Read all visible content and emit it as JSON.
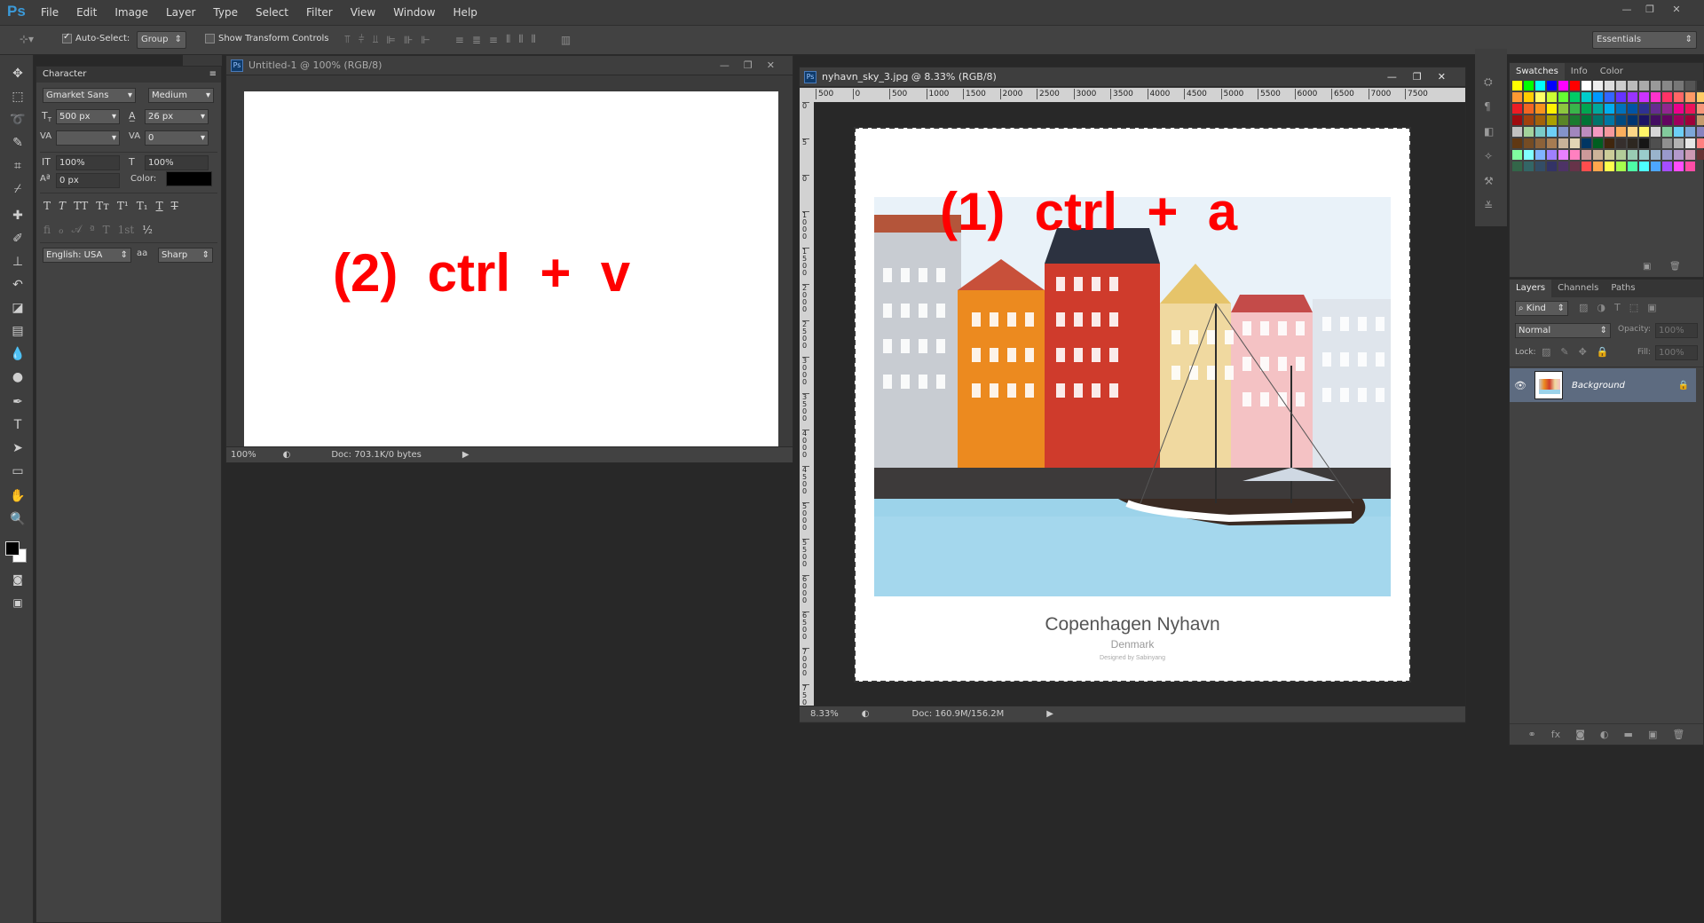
{
  "app": {
    "logo": "Ps",
    "menus": [
      "File",
      "Edit",
      "Image",
      "Layer",
      "Type",
      "Select",
      "Filter",
      "View",
      "Window",
      "Help"
    ],
    "workspace": "Essentials"
  },
  "options": {
    "auto_select_label": "Auto-Select:",
    "auto_select_checked": true,
    "auto_select_value": "Group",
    "show_transform_label": "Show Transform Controls",
    "show_transform_checked": false
  },
  "tools": [
    "move-icon",
    "marquee-icon",
    "lasso-icon",
    "quick-select-icon",
    "crop-icon",
    "eyedropper-icon",
    "spot-heal-icon",
    "brush-icon",
    "stamp-icon",
    "history-brush-icon",
    "eraser-icon",
    "gradient-icon",
    "blur-icon",
    "dodge-icon",
    "pen-icon",
    "type-icon",
    "path-select-icon",
    "shape-icon",
    "hand-icon",
    "zoom-icon"
  ],
  "character": {
    "title": "Character",
    "font_family": "Gmarket Sans",
    "font_style": "Medium",
    "size": "500 px",
    "leading": "26 px",
    "kerning": "",
    "tracking": "0",
    "vscale": "100%",
    "hscale": "100%",
    "baseline": "0 px",
    "color_label": "Color:",
    "color": "#000000",
    "language": "English: USA",
    "aa_label": "aa",
    "antialias": "Sharp"
  },
  "doc1": {
    "title": "Untitled-1 @ 100% (RGB/8)",
    "zoom": "100%",
    "status": "Doc: 703.1K/0 bytes",
    "annotation": "(2)  ctrl  +  v"
  },
  "doc2": {
    "title": "nyhavn_sky_3.jpg @ 8.33% (RGB/8)",
    "zoom": "8.33%",
    "status": "Doc: 160.9M/156.2M",
    "ruler_h": [
      "500",
      "0",
      "500",
      "1000",
      "1500",
      "2000",
      "2500",
      "3000",
      "3500",
      "4000",
      "4500",
      "5000",
      "5500",
      "6000",
      "6500",
      "7000",
      "7500"
    ],
    "ruler_v": [
      "0",
      "5",
      "0",
      "1000",
      "1500",
      "2000",
      "2500",
      "3000",
      "3500",
      "4000",
      "4500",
      "5000",
      "5500",
      "6000",
      "6500",
      "7000",
      "7500"
    ],
    "annotation": "(1)  ctrl  +  a",
    "poster_title": "Copenhagen Nyhavn",
    "poster_subtitle": "Denmark",
    "poster_credit": "Designed by Sabinyang"
  },
  "swatches_panel": {
    "tabs": [
      "Swatches",
      "Info",
      "Color"
    ],
    "colors": [
      "#ffff00",
      "#00ff00",
      "#00ffff",
      "#0000ff",
      "#ff00ff",
      "#ff0000",
      "#ffffff",
      "#eeeeee",
      "#dddddd",
      "#cccccc",
      "#bbbbbb",
      "#aaaaaa",
      "#999999",
      "#888888",
      "#777777",
      "#555555",
      "#333333",
      "#000000",
      "#ff0000",
      "#ff6600",
      "#ff9933",
      "#ffcc00",
      "#ffff66",
      "#ccff33",
      "#66ff33",
      "#00cc66",
      "#00cccc",
      "#0099ff",
      "#3366ff",
      "#6633ff",
      "#9933ff",
      "#cc33ff",
      "#ff33cc",
      "#ff3366",
      "#ff6666",
      "#ff9966",
      "#ffcc66",
      "#ffff99",
      "#ccff99",
      "#99ff99",
      "#ed1c24",
      "#f26522",
      "#f7941d",
      "#fff200",
      "#8dc63f",
      "#39b54a",
      "#00a651",
      "#00a99d",
      "#00aeef",
      "#0072bc",
      "#0054a6",
      "#2e3192",
      "#662d91",
      "#92278f",
      "#ec008c",
      "#ed145b",
      "#f69679",
      "#f9ad81",
      "#fdc68a",
      "#fff79a",
      "#9e0b0f",
      "#a0410d",
      "#a3620a",
      "#aba000",
      "#598527",
      "#1a7b30",
      "#007236",
      "#00746b",
      "#0076a3",
      "#004a80",
      "#003471",
      "#1b1464",
      "#440e62",
      "#630460",
      "#9e005d",
      "#9e0039",
      "#c69c6d",
      "#998675",
      "#736357",
      "#534741",
      "#c2c2c2",
      "#a3d39c",
      "#7accc8",
      "#6dcff6",
      "#8393ca",
      "#a187be",
      "#bd8cbf",
      "#f49ac1",
      "#f5989d",
      "#fbaf5d",
      "#fdd687",
      "#fff568",
      "#d7d7d7",
      "#82ca9c",
      "#6ccff6",
      "#7da7d9",
      "#8882be",
      "#a186be",
      "#f06eaa",
      "#f26c4f",
      "#603813",
      "#754c24",
      "#8c6239",
      "#a67c52",
      "#c7b299",
      "#e2d6b5",
      "#003663",
      "#005e20",
      "#40260e",
      "#362f2d",
      "#2d2720",
      "#161616",
      "#4f4f4f",
      "#8f8f8f",
      "#b2b2b2",
      "#e6e6e6",
      "#ff8080",
      "#ffb380",
      "#ffe680",
      "#d9ff80",
      "#80ff9f",
      "#80ffff",
      "#80b3ff",
      "#9f80ff",
      "#e680ff",
      "#ff80c0",
      "#cc9999",
      "#ccb399",
      "#cccc99",
      "#b3cc99",
      "#99ccb3",
      "#99cccc",
      "#99b3cc",
      "#9999cc",
      "#b399cc",
      "#cc99b3",
      "#663333",
      "#664d33",
      "#666633",
      "#4d6633",
      "#336649",
      "#336666",
      "#334d66",
      "#333366",
      "#4d3366",
      "#663349",
      "#ff4d4d",
      "#ffa64d",
      "#ffff4d",
      "#a6ff4d",
      "#4dffa6",
      "#4dffff",
      "#4da6ff",
      "#a64dff",
      "#ff4dff",
      "#ff4da6"
    ]
  },
  "layers_panel": {
    "tabs": [
      "Layers",
      "Channels",
      "Paths"
    ],
    "kind_label": "Kind",
    "blend_mode": "Normal",
    "opacity_label": "Opacity:",
    "opacity": "100%",
    "lock_label": "Lock:",
    "fill_label": "Fill:",
    "fill": "100%",
    "layer_name": "Background"
  }
}
